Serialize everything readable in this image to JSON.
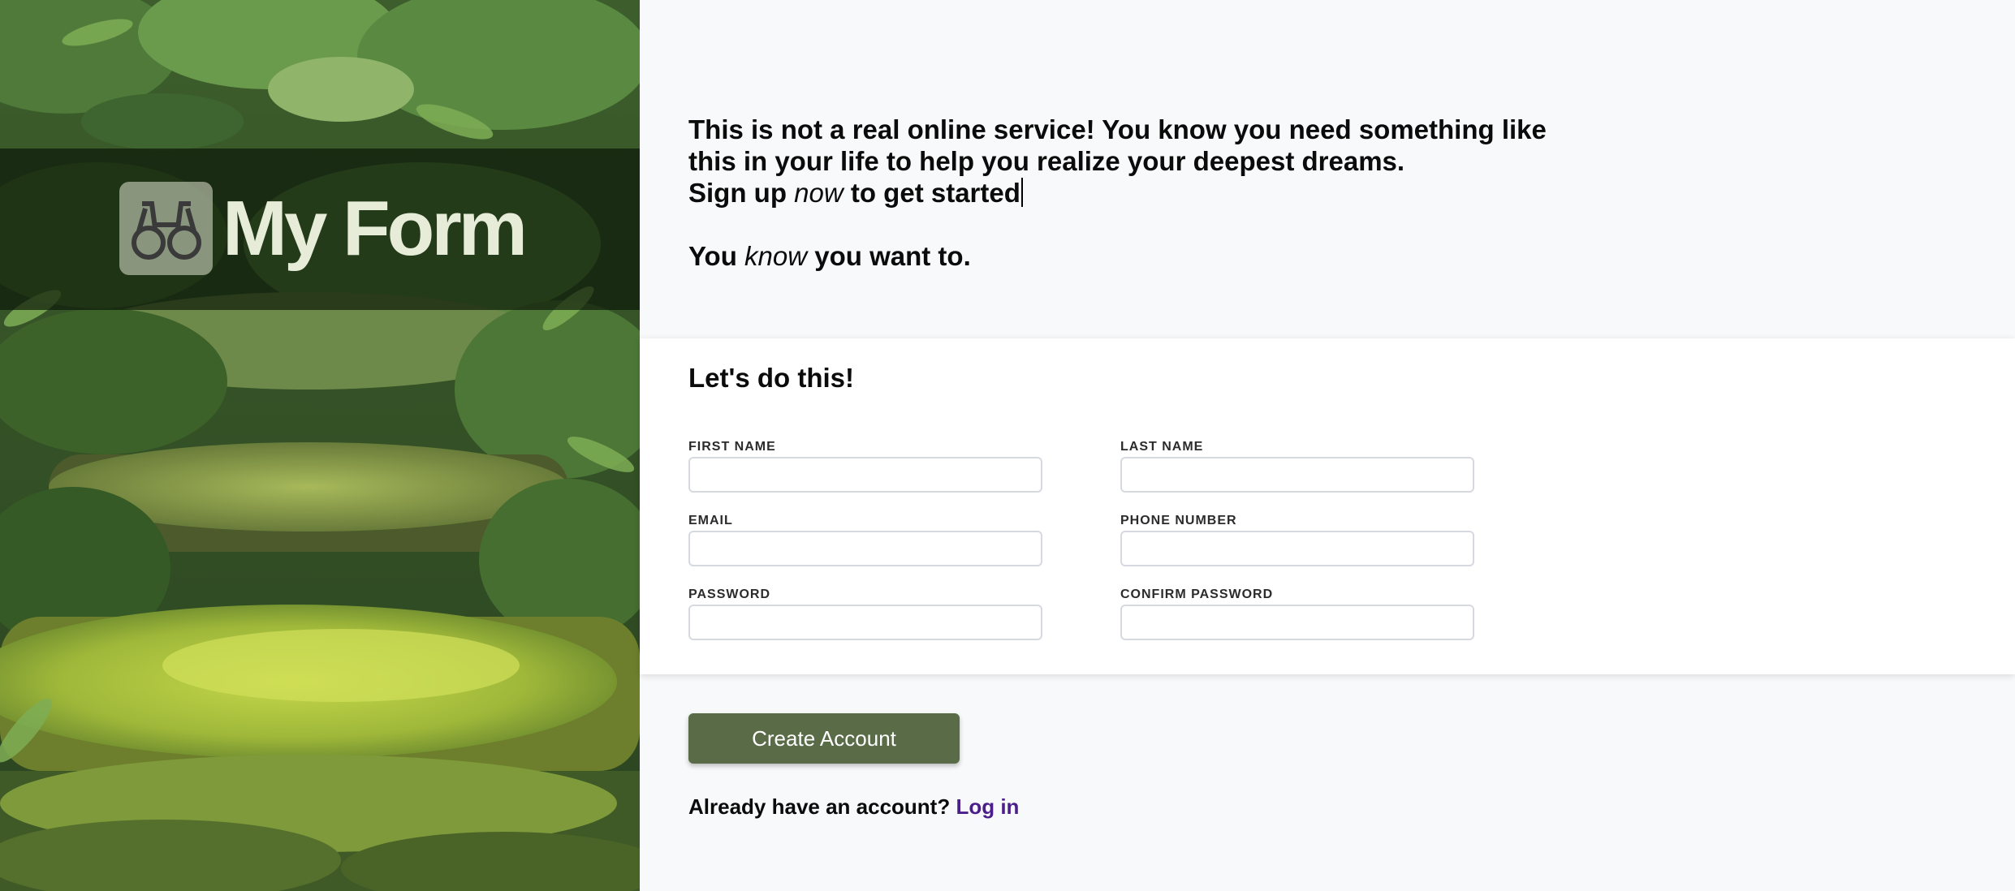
{
  "brand": {
    "name": "My Form",
    "logo_icon": "binoculars-icon"
  },
  "intro": {
    "line1": "This is not a real online service! You know you need something like",
    "line2": "this in your life to help you realize your deepest dreams.",
    "line3_before": "Sign up ",
    "line3_emphasis": "now",
    "line3_after": " to get started",
    "line4_before": "You ",
    "line4_emphasis": "know",
    "line4_after": " you want to."
  },
  "form": {
    "title": "Let's do this!",
    "fields": {
      "first_name": {
        "label": "FIRST NAME",
        "value": ""
      },
      "last_name": {
        "label": "LAST NAME",
        "value": ""
      },
      "email": {
        "label": "EMAIL",
        "value": ""
      },
      "phone": {
        "label": "PHONE NUMBER",
        "value": ""
      },
      "password": {
        "label": "PASSWORD",
        "value": ""
      },
      "confirm_password": {
        "label": "CONFIRM PASSWORD",
        "value": ""
      }
    }
  },
  "actions": {
    "create_account_label": "Create Account",
    "login_prompt": "Already have an account?",
    "login_link": "Log in"
  },
  "colors": {
    "page_background": "#f8f9fa",
    "button": "#5a6b48",
    "link": "#4b1f8a"
  }
}
